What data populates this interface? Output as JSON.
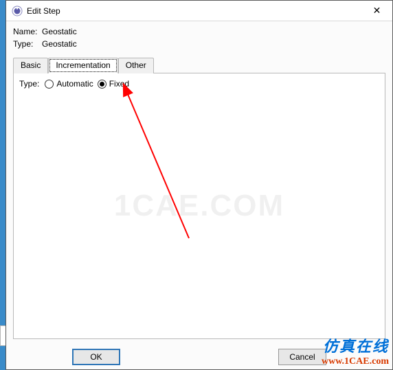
{
  "window": {
    "title": "Edit Step",
    "close_glyph": "✕"
  },
  "fields": {
    "name_label": "Name:",
    "name_value": "Geostatic",
    "type_label": "Type:",
    "type_value": "Geostatic"
  },
  "tabs": {
    "basic": "Basic",
    "increment": "Incrementation",
    "other": "Other",
    "active": "increment"
  },
  "incrementation": {
    "type_label": "Type:",
    "automatic_label": "Automatic",
    "fixed_label": "Fixed",
    "selected": "fixed"
  },
  "buttons": {
    "ok": "OK",
    "cancel": "Cancel"
  },
  "watermark": {
    "center": "1CAE.COM",
    "line1": "仿真在线",
    "line2": "www.1CAE.com"
  }
}
